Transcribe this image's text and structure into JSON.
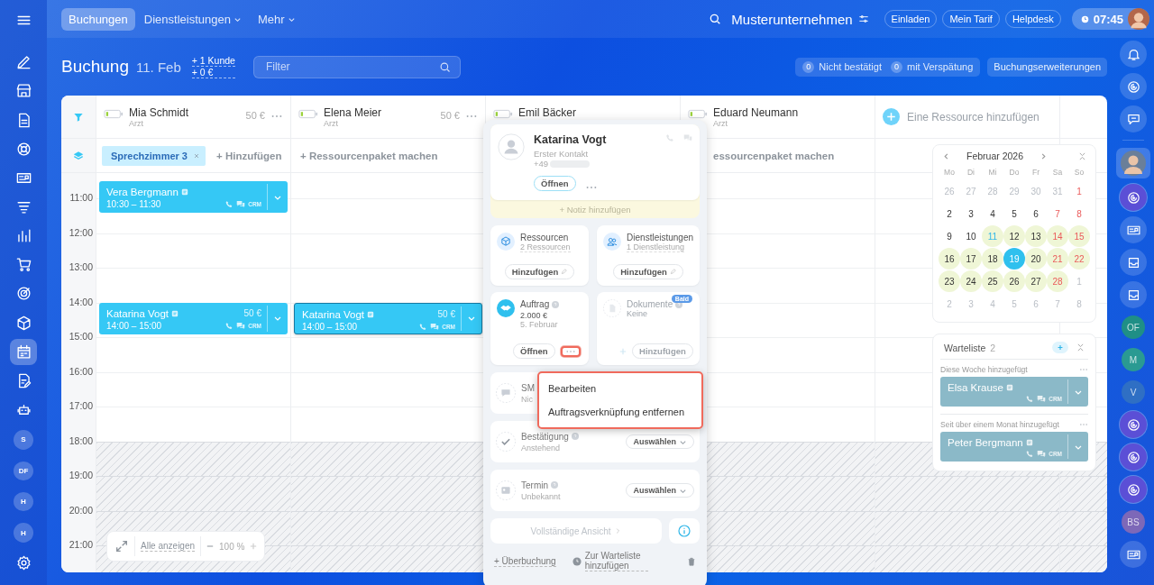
{
  "sidebar": {
    "items": [
      {
        "kind": "icon",
        "selected": false
      },
      {
        "kind": "icon",
        "selected": false
      },
      {
        "kind": "icon",
        "selected": false
      },
      {
        "kind": "icon",
        "selected": false
      },
      {
        "kind": "icon",
        "selected": false
      },
      {
        "kind": "icon",
        "selected": false
      },
      {
        "kind": "icon",
        "selected": false
      },
      {
        "kind": "icon",
        "selected": false
      },
      {
        "kind": "icon",
        "selected": false
      },
      {
        "kind": "icon",
        "selected": false
      },
      {
        "kind": "icon",
        "selected": false
      },
      {
        "kind": "icon",
        "selected": true
      },
      {
        "kind": "icon",
        "selected": false
      },
      {
        "kind": "icon",
        "selected": false
      },
      {
        "kind": "initials",
        "label": "S",
        "selected": false
      },
      {
        "kind": "initials",
        "label": "DF",
        "selected": false
      },
      {
        "kind": "initials",
        "label": "H",
        "selected": false
      },
      {
        "kind": "initials",
        "label": "H",
        "selected": false
      },
      {
        "kind": "icon",
        "selected": false
      }
    ]
  },
  "topbar": {
    "tabs": [
      {
        "label": "Buchungen",
        "dropdown": false,
        "selected": true
      },
      {
        "label": "Dienstleistungen",
        "dropdown": true,
        "selected": false
      },
      {
        "label": "Mehr",
        "dropdown": true,
        "selected": false
      }
    ],
    "company": "Musterunternehmen",
    "buttons": [
      "Einladen",
      "Mein Tarif",
      "Helpdesk"
    ],
    "clock": "07:45"
  },
  "header": {
    "title": "Buchung",
    "date": "11. Feb",
    "stats": [
      "+ 1 Kunde",
      "+ 0 €"
    ],
    "filter": {
      "placeholder": "Filter"
    },
    "counters": [
      {
        "count": "0",
        "label": "Nicht bestätigt"
      },
      {
        "count": "0",
        "label": "mit Verspätung"
      }
    ],
    "extensions_button": "Buchungserweiterungen"
  },
  "calendar": {
    "resources": [
      {
        "name": "Mia Schmidt",
        "role": "Arzt",
        "price": "50 €",
        "chips": [
          {
            "label": "Sprechzimmer 3"
          }
        ],
        "action": "+ Hinzufügen",
        "events": [
          {
            "name": "Vera Bergmann",
            "time": "10:30 – 11:30",
            "crm": "CRM",
            "selected": false
          },
          {
            "name": "Katarina Vogt",
            "time": "14:00 – 15:00",
            "price": "50 €",
            "crm": "CRM",
            "selected": false
          }
        ]
      },
      {
        "name": "Elena Meier",
        "role": "Arzt",
        "price": "50 €",
        "action": "+ Ressourcenpaket machen",
        "events": [
          {
            "name": "Katarina Vogt",
            "time": "14:00 – 15:00",
            "price": "50 €",
            "crm": "CRM",
            "selected": true
          }
        ]
      },
      {
        "name": "Emil Bäcker"
      },
      {
        "name": "Eduard Neumann",
        "role": "Arzt",
        "action": "essourcenpaket machen"
      }
    ],
    "add_resource": "Eine Ressource hinzufügen",
    "hours": [
      {
        "label": "11:00",
        "closed": false
      },
      {
        "label": "12:00",
        "closed": false
      },
      {
        "label": "13:00",
        "closed": false
      },
      {
        "label": "14:00",
        "closed": false
      },
      {
        "label": "15:00",
        "closed": false
      },
      {
        "label": "16:00",
        "closed": false
      },
      {
        "label": "17:00",
        "closed": false
      },
      {
        "label": "18:00",
        "closed": true
      },
      {
        "label": "19:00",
        "closed": true
      },
      {
        "label": "20:00",
        "closed": true
      },
      {
        "label": "21:00",
        "closed": true
      }
    ],
    "zoom_bar": {
      "show_all": "Alle anzeigen",
      "zoom": "100 %"
    }
  },
  "mini_calendar": {
    "title": "Februar 2026",
    "weekdays": [
      "Mo",
      "Di",
      "Mi",
      "Do",
      "Fr",
      "Sa",
      "So"
    ],
    "weeks": [
      [
        {
          "day": "26",
          "kind": "other",
          "selected": false
        },
        {
          "day": "27",
          "kind": "other",
          "selected": false
        },
        {
          "day": "28",
          "kind": "other",
          "selected": false
        },
        {
          "day": "29",
          "kind": "other",
          "selected": false
        },
        {
          "day": "30",
          "kind": "other",
          "selected": false
        },
        {
          "day": "31",
          "kind": "other",
          "selected": false
        },
        {
          "day": "1",
          "kind": "weekend",
          "selected": false
        }
      ],
      [
        {
          "day": "2",
          "kind": "plain",
          "selected": false
        },
        {
          "day": "3",
          "kind": "plain",
          "selected": false
        },
        {
          "day": "4",
          "kind": "plain",
          "selected": false
        },
        {
          "day": "5",
          "kind": "plain",
          "selected": false
        },
        {
          "day": "6",
          "kind": "plain",
          "selected": false
        },
        {
          "day": "7",
          "kind": "weekend",
          "selected": false
        },
        {
          "day": "8",
          "kind": "weekend",
          "selected": false
        }
      ],
      [
        {
          "day": "9",
          "kind": "plain",
          "selected": false
        },
        {
          "day": "10",
          "kind": "plain",
          "selected": false
        },
        {
          "day": "11",
          "kind": "marked-today",
          "selected": false
        },
        {
          "day": "12",
          "kind": "marked",
          "selected": false
        },
        {
          "day": "13",
          "kind": "marked",
          "selected": false
        },
        {
          "day": "14",
          "kind": "marked-weekend",
          "selected": false
        },
        {
          "day": "15",
          "kind": "marked-weekend",
          "selected": false
        }
      ],
      [
        {
          "day": "16",
          "kind": "marked",
          "selected": false
        },
        {
          "day": "17",
          "kind": "marked",
          "selected": false
        },
        {
          "day": "18",
          "kind": "marked",
          "selected": false
        },
        {
          "day": "19",
          "kind": "marked",
          "selected": true
        },
        {
          "day": "20",
          "kind": "marked",
          "selected": false
        },
        {
          "day": "21",
          "kind": "marked-weekend",
          "selected": false
        },
        {
          "day": "22",
          "kind": "marked-weekend",
          "selected": false
        }
      ],
      [
        {
          "day": "23",
          "kind": "marked",
          "selected": false
        },
        {
          "day": "24",
          "kind": "marked",
          "selected": false
        },
        {
          "day": "25",
          "kind": "marked",
          "selected": false
        },
        {
          "day": "26",
          "kind": "marked",
          "selected": false
        },
        {
          "day": "27",
          "kind": "marked",
          "selected": false
        },
        {
          "day": "28",
          "kind": "marked-weekend",
          "selected": false
        },
        {
          "day": "1",
          "kind": "other",
          "selected": false
        }
      ],
      [
        {
          "day": "2",
          "kind": "other",
          "selected": false
        },
        {
          "day": "3",
          "kind": "other",
          "selected": false
        },
        {
          "day": "4",
          "kind": "other",
          "selected": false
        },
        {
          "day": "5",
          "kind": "other",
          "selected": false
        },
        {
          "day": "6",
          "kind": "other",
          "selected": false
        },
        {
          "day": "7",
          "kind": "other",
          "selected": false
        },
        {
          "day": "8",
          "kind": "other",
          "selected": false
        }
      ]
    ]
  },
  "waitlist": {
    "title": "Warteliste",
    "count": "2",
    "groups": [
      {
        "label": "Diese Woche hinzugefügt",
        "entries": [
          {
            "name": "Elsa Krause",
            "crm": "CRM"
          }
        ]
      },
      {
        "label": "Seit über einem Monat hinzugefügt",
        "entries": [
          {
            "name": "Peter Bergmann",
            "crm": "CRM"
          }
        ]
      }
    ]
  },
  "right_bar": {
    "items": [
      {
        "kind": "icon",
        "selected": false
      },
      {
        "kind": "icon",
        "selected": false
      },
      {
        "kind": "icon",
        "selected": false
      },
      {
        "kind": "avatar",
        "selected": true
      },
      {
        "kind": "icon",
        "selected": false
      },
      {
        "kind": "icon",
        "selected": false
      },
      {
        "kind": "icon",
        "selected": false
      },
      {
        "kind": "icon",
        "selected": false
      },
      {
        "kind": "initials",
        "label": "OF",
        "color": "#1f8f86",
        "selected": false
      },
      {
        "kind": "initials",
        "label": "M",
        "color": "#2a9a92",
        "selected": false
      },
      {
        "kind": "initials",
        "label": "V",
        "color": "#2f6fc4",
        "selected": false
      },
      {
        "kind": "icon",
        "selected": false
      },
      {
        "kind": "icon",
        "selected": false
      },
      {
        "kind": "icon",
        "selected": false
      },
      {
        "kind": "initials",
        "label": "BS",
        "color": "#7d68b8",
        "selected": false
      },
      {
        "kind": "icon",
        "selected": false
      }
    ]
  },
  "popup": {
    "client": {
      "name": "Katarina Vogt",
      "subtitle": "Erster Kontakt",
      "phone": "+49",
      "open_button": "Öffnen"
    },
    "note": "+ Notiz hinzufügen",
    "tiles": [
      {
        "kind": "resources",
        "title": "Ressourcen",
        "subtitle": "2 Ressourcen",
        "button": "Hinzufügen",
        "disabled": false
      },
      {
        "kind": "services",
        "title": "Dienstleistungen",
        "subtitle": "1 Dienstleistung",
        "button": "Hinzufügen",
        "disabled": false
      },
      {
        "kind": "order",
        "title": "Auftrag",
        "lines": [
          "2.000 €",
          "5. Februar"
        ],
        "button": "Öffnen",
        "disabled": false
      },
      {
        "kind": "documents",
        "title": "Dokumente",
        "subtitle": "Keine",
        "button": "Hinzufügen",
        "badge": "Bald",
        "disabled": true
      }
    ],
    "rows": [
      {
        "kind": "sms",
        "title": "SM",
        "subtitle": "Nic"
      },
      {
        "kind": "confirm",
        "title": "Bestätigung",
        "subtitle": "Anstehend",
        "button": "Auswählen"
      },
      {
        "kind": "appointment",
        "title": "Termin",
        "subtitle": "Unbekannt",
        "button": "Auswählen"
      }
    ],
    "full_view": "Vollständige Ansicht",
    "overbooking": "+ Überbuchung",
    "waitlist_link": "Zur Warteliste hinzufügen",
    "menu": [
      "Bearbeiten",
      "Auftragsverknüpfung entfernen"
    ]
  }
}
